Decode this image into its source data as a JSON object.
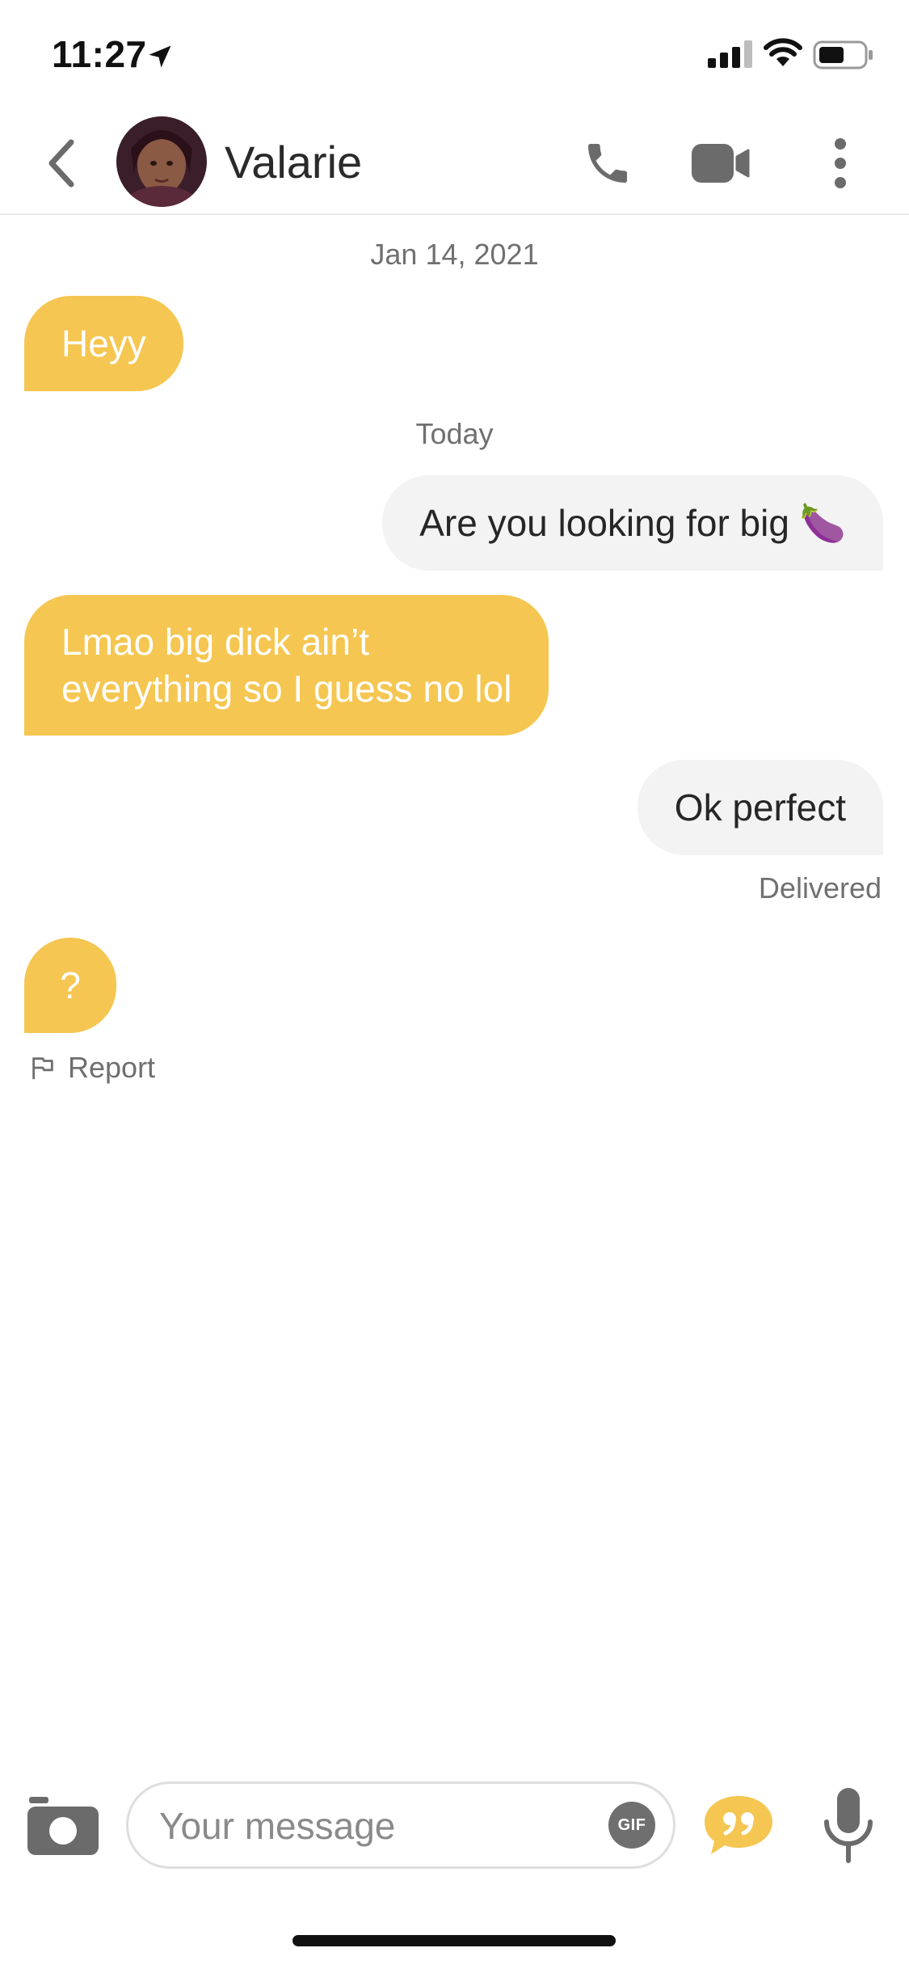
{
  "status_bar": {
    "time": "11:27"
  },
  "header": {
    "back_label": "",
    "contact_name": "Valarie"
  },
  "messages": [
    {
      "type": "date",
      "text": "Jan 14, 2021"
    },
    {
      "type": "incoming",
      "text": "Heyy"
    },
    {
      "type": "date",
      "text": "Today"
    },
    {
      "type": "outgoing",
      "text": "Are you looking for big 🍆"
    },
    {
      "type": "incoming",
      "text": "Lmao big dick ain’t everything so I guess no lol",
      "lines": [
        "Lmao big dick ain’t",
        "everything so I guess no lol"
      ]
    },
    {
      "type": "outgoing",
      "text": "Ok perfect"
    },
    {
      "type": "incoming",
      "text": "?"
    }
  ],
  "delivered_label": "Delivered",
  "report_label": "Report",
  "composer": {
    "placeholder": "Your message",
    "gif_label": "GIF"
  },
  "colors": {
    "incoming_bubble": "#f5c651",
    "outgoing_bubble": "#f3f3f3",
    "accent": "#f5c651",
    "icon_gray": "#6b6b6b"
  }
}
